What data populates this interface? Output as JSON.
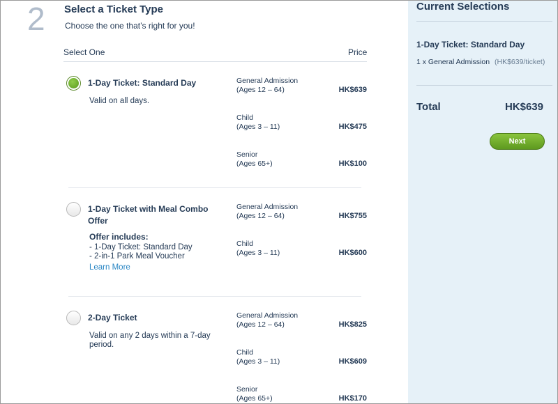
{
  "step": {
    "number": "2",
    "title": "Select a Ticket Type",
    "subtitle": "Choose the one that’s right for you!"
  },
  "columns": {
    "select": "Select One",
    "price": "Price"
  },
  "tickets": [
    {
      "name": "1-Day Ticket: Standard Day",
      "selected": true,
      "description": "Valid on all days.",
      "prices": [
        {
          "label_1": "General Admission",
          "label_2": "(Ages 12 – 64)",
          "value": "HK$639"
        },
        {
          "label_1": "Child",
          "label_2": "(Ages 3 – 11)",
          "value": "HK$475"
        },
        {
          "label_1": "Senior",
          "label_2": "(Ages 65+)",
          "value": "HK$100"
        }
      ]
    },
    {
      "name": "1-Day Ticket with Meal Combo Offer",
      "selected": false,
      "offer_title": "Offer includes:",
      "offer_items": [
        "- 1-Day Ticket: Standard Day",
        "- 2-in-1 Park Meal Voucher"
      ],
      "learn_more": "Learn More",
      "prices": [
        {
          "label_1": "General Admission",
          "label_2": "(Ages 12 – 64)",
          "value": "HK$755"
        },
        {
          "label_1": "Child",
          "label_2": "(Ages 3 – 11)",
          "value": "HK$600"
        }
      ]
    },
    {
      "name": "2-Day Ticket",
      "selected": false,
      "description": "Valid on any 2 days within a 7-day period.",
      "prices": [
        {
          "label_1": "General Admission",
          "label_2": "(Ages 12 – 64)",
          "value": "HK$825"
        },
        {
          "label_1": "Child",
          "label_2": "(Ages 3 – 11)",
          "value": "HK$609"
        },
        {
          "label_1": "Senior",
          "label_2": "(Ages 65+)",
          "value": "HK$170"
        }
      ]
    }
  ],
  "sidebar": {
    "title": "Current Selections",
    "ticket_name": "1-Day Ticket: Standard Day",
    "line_item": "1 x General Admission",
    "per_ticket": "(HK$639/ticket)",
    "total_label": "Total",
    "total_value": "HK$639",
    "next_label": "Next"
  },
  "colors": {
    "text": "#253b56",
    "accent_green": "#6aa62a",
    "link": "#2a86c4",
    "sidebar_bg": "#e6f1f8"
  }
}
